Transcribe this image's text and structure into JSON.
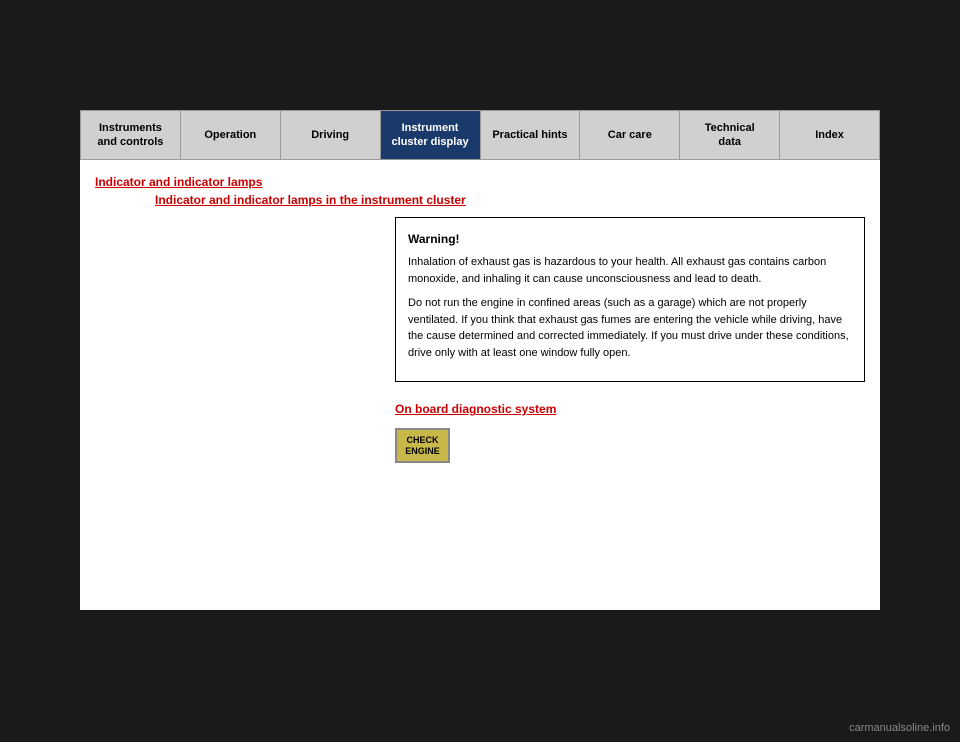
{
  "nav": {
    "items": [
      {
        "id": "instruments",
        "label": "Instruments\nand controls",
        "active": false
      },
      {
        "id": "operation",
        "label": "Operation",
        "active": false
      },
      {
        "id": "driving",
        "label": "Driving",
        "active": false
      },
      {
        "id": "instrument-cluster",
        "label": "Instrument\ncluster display",
        "active": true
      },
      {
        "id": "practical-hints",
        "label": "Practical hints",
        "active": false
      },
      {
        "id": "car-care",
        "label": "Car care",
        "active": false
      },
      {
        "id": "technical-data",
        "label": "Technical\ndata",
        "active": false
      },
      {
        "id": "index",
        "label": "Index",
        "active": false
      }
    ]
  },
  "breadcrumb": {
    "main": "Indicator and indicator lamps",
    "sub": "Indicator and indicator lamps\nin the instrument cluster"
  },
  "warning": {
    "title": "Warning!",
    "paragraph1": "Inhalation of exhaust gas is hazardous to your health. All exhaust gas contains carbon monoxide, and inhaling it can cause unconsciousness and lead to death.",
    "paragraph2": "Do not run the engine in confined areas (such as a garage) which are not properly ventilated. If you think that exhaust gas fumes are entering the vehicle while driving, have the cause determined and corrected immediately. If you must drive under these conditions, drive only with at least one window fully open."
  },
  "diagnostics": {
    "title": "On board diagnostic system",
    "check_engine_label": "CHECK\nENGINE"
  },
  "watermark": "carmanualsoline.info"
}
